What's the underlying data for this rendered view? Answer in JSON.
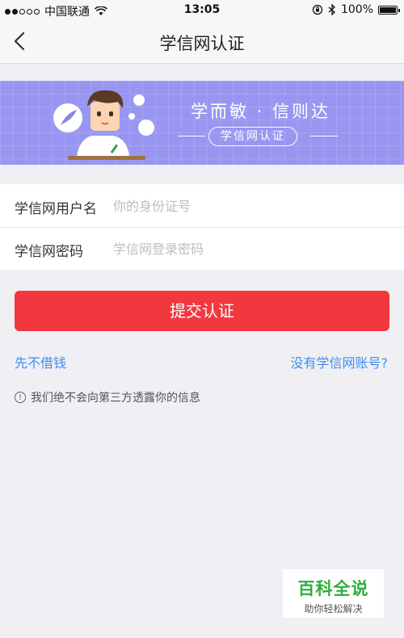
{
  "status_bar": {
    "carrier": "中国联通",
    "time": "13:05",
    "battery": "100%"
  },
  "nav": {
    "title": "学信网认证",
    "back_icon": "chevron-left-icon"
  },
  "banner": {
    "slogan": "学而敏 · 信则达",
    "tag": "学信网认证"
  },
  "form": {
    "username_label": "学信网用户名",
    "username_placeholder": "你的身份证号",
    "username_value": "",
    "password_label": "学信网密码",
    "password_placeholder": "学信网登录密码",
    "password_value": ""
  },
  "actions": {
    "submit_label": "提交认证",
    "skip_link": "先不借钱",
    "no_account_link": "没有学信网账号?"
  },
  "notice": {
    "icon": "exclamation-circle-icon",
    "text": "我们绝不会向第三方透露你的信息"
  },
  "watermark": {
    "title": "百科全说",
    "subtitle": "助你轻松解决"
  },
  "colors": {
    "accent_red": "#f2383f",
    "link_blue": "#3b8ff0",
    "banner_purple": "#9896f0"
  }
}
